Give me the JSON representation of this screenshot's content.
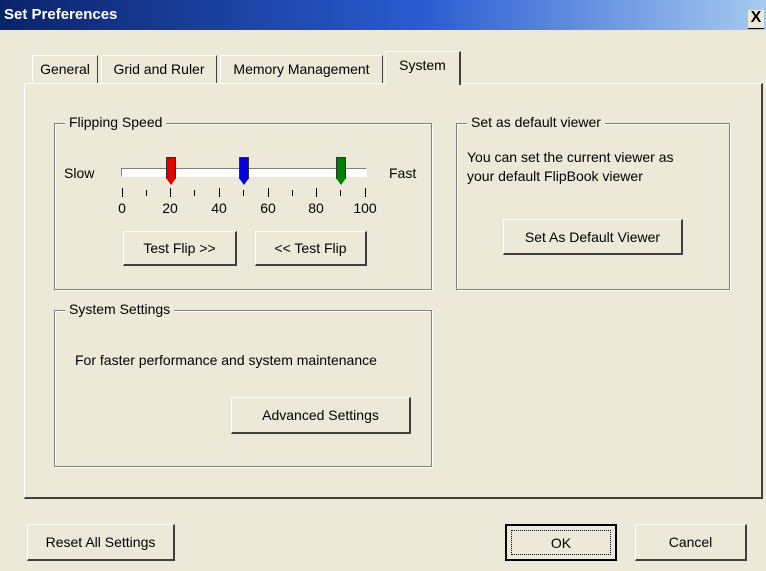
{
  "window": {
    "title": "Set Preferences",
    "close_glyph": "X"
  },
  "tabs": [
    {
      "label": "General",
      "active": false
    },
    {
      "label": "Grid and Ruler",
      "active": false
    },
    {
      "label": "Memory Management",
      "active": false
    },
    {
      "label": "System",
      "active": true
    }
  ],
  "flipping_speed": {
    "legend": "Flipping Speed",
    "slow_label": "Slow",
    "fast_label": "Fast",
    "tick_labels": [
      "0",
      "20",
      "40",
      "60",
      "80",
      "100"
    ],
    "markers": [
      {
        "name": "red",
        "value": 20,
        "color": "#e00000"
      },
      {
        "name": "blue",
        "value": 50,
        "color": "#0000e0"
      },
      {
        "name": "green",
        "value": 90,
        "color": "#008000"
      }
    ],
    "test_flip_forward_label": "Test Flip >>",
    "test_flip_back_label": "<< Test Flip"
  },
  "default_viewer": {
    "legend": "Set as default viewer",
    "description_line1": "You can set the current viewer as",
    "description_line2": "your default FlipBook viewer",
    "button_label": "Set As Default Viewer"
  },
  "system_settings": {
    "legend": "System Settings",
    "description": "For faster performance and system maintenance",
    "button_label": "Advanced Settings"
  },
  "footer": {
    "reset_label": "Reset All Settings",
    "ok_label": "OK",
    "cancel_label": "Cancel"
  },
  "colors": {
    "dialog_bg": "#ece9d8",
    "titlebar_start": "#0a246a",
    "titlebar_end": "#a6caf0"
  }
}
